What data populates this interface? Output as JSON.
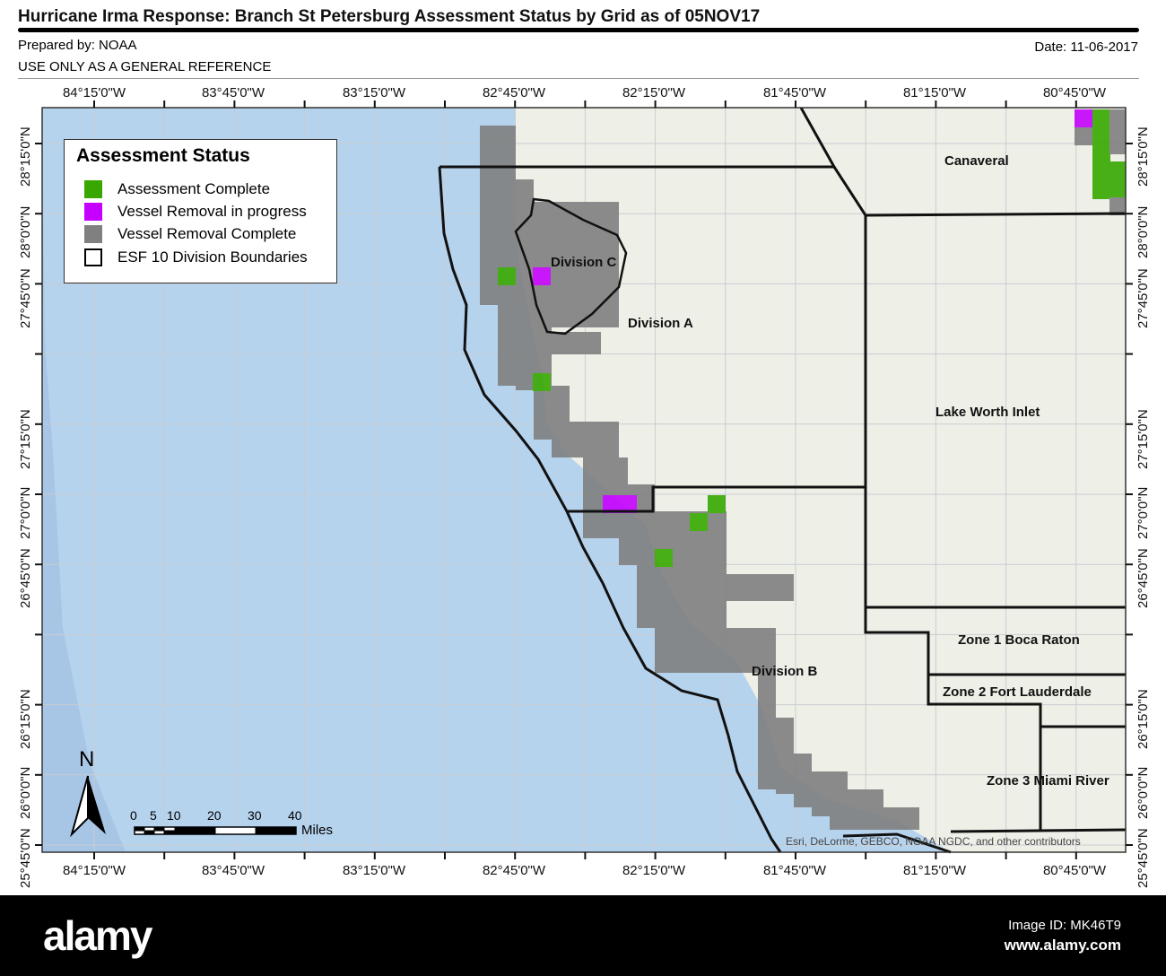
{
  "header": {
    "title": "Hurricane Irma Response: Branch St Petersburg Assessment Status by Grid as of 05NOV17",
    "prepared_by": "Prepared by: NOAA",
    "date": "Date: 11-06-2017",
    "disclaimer": "USE ONLY AS A GENERAL REFERENCE"
  },
  "longitude_labels": [
    "84°15'0\"W",
    "83°45'0\"W",
    "83°15'0\"W",
    "82°45'0\"W",
    "82°15'0\"W",
    "81°45'0\"W",
    "81°15'0\"W",
    "80°45'0\"W"
  ],
  "latitude_labels": [
    "28°15'0\"N",
    "28°0'0\"N",
    "27°45'0\"N",
    "27°15'0\"N",
    "27°0'0\"N",
    "26°45'0\"N",
    "26°15'0\"N",
    "26°0'0\"N",
    "25°45'0\"N"
  ],
  "legend": {
    "title": "Assessment Status",
    "items": [
      {
        "label": "Assessment Complete",
        "color": "#38a800"
      },
      {
        "label": "Vessel Removal in progress",
        "color": "#c500ff"
      },
      {
        "label": "Vessel Removal Complete",
        "color": "#808080"
      },
      {
        "label": "ESF 10 Division Boundaries",
        "color": "#000000"
      }
    ]
  },
  "regions": {
    "division_c": "Division C",
    "division_a": "Division A",
    "division_b": "Division B",
    "canaveral": "Canaveral",
    "lake_worth": "Lake Worth Inlet",
    "zone1": "Zone 1 Boca Raton",
    "zone2": "Zone 2 Fort Lauderdale",
    "zone3": "Zone 3 Miami River"
  },
  "north": "N",
  "scale": {
    "ticks": [
      "0",
      "5",
      "10",
      "20",
      "30",
      "40"
    ],
    "unit": "Miles"
  },
  "attribution": "Esri, DeLorme, GEBCO, NOAA NGDC, and other contributors",
  "footer": {
    "logo": "alamy",
    "image_id": "Image ID: MK46T9",
    "site": "www.alamy.com"
  }
}
